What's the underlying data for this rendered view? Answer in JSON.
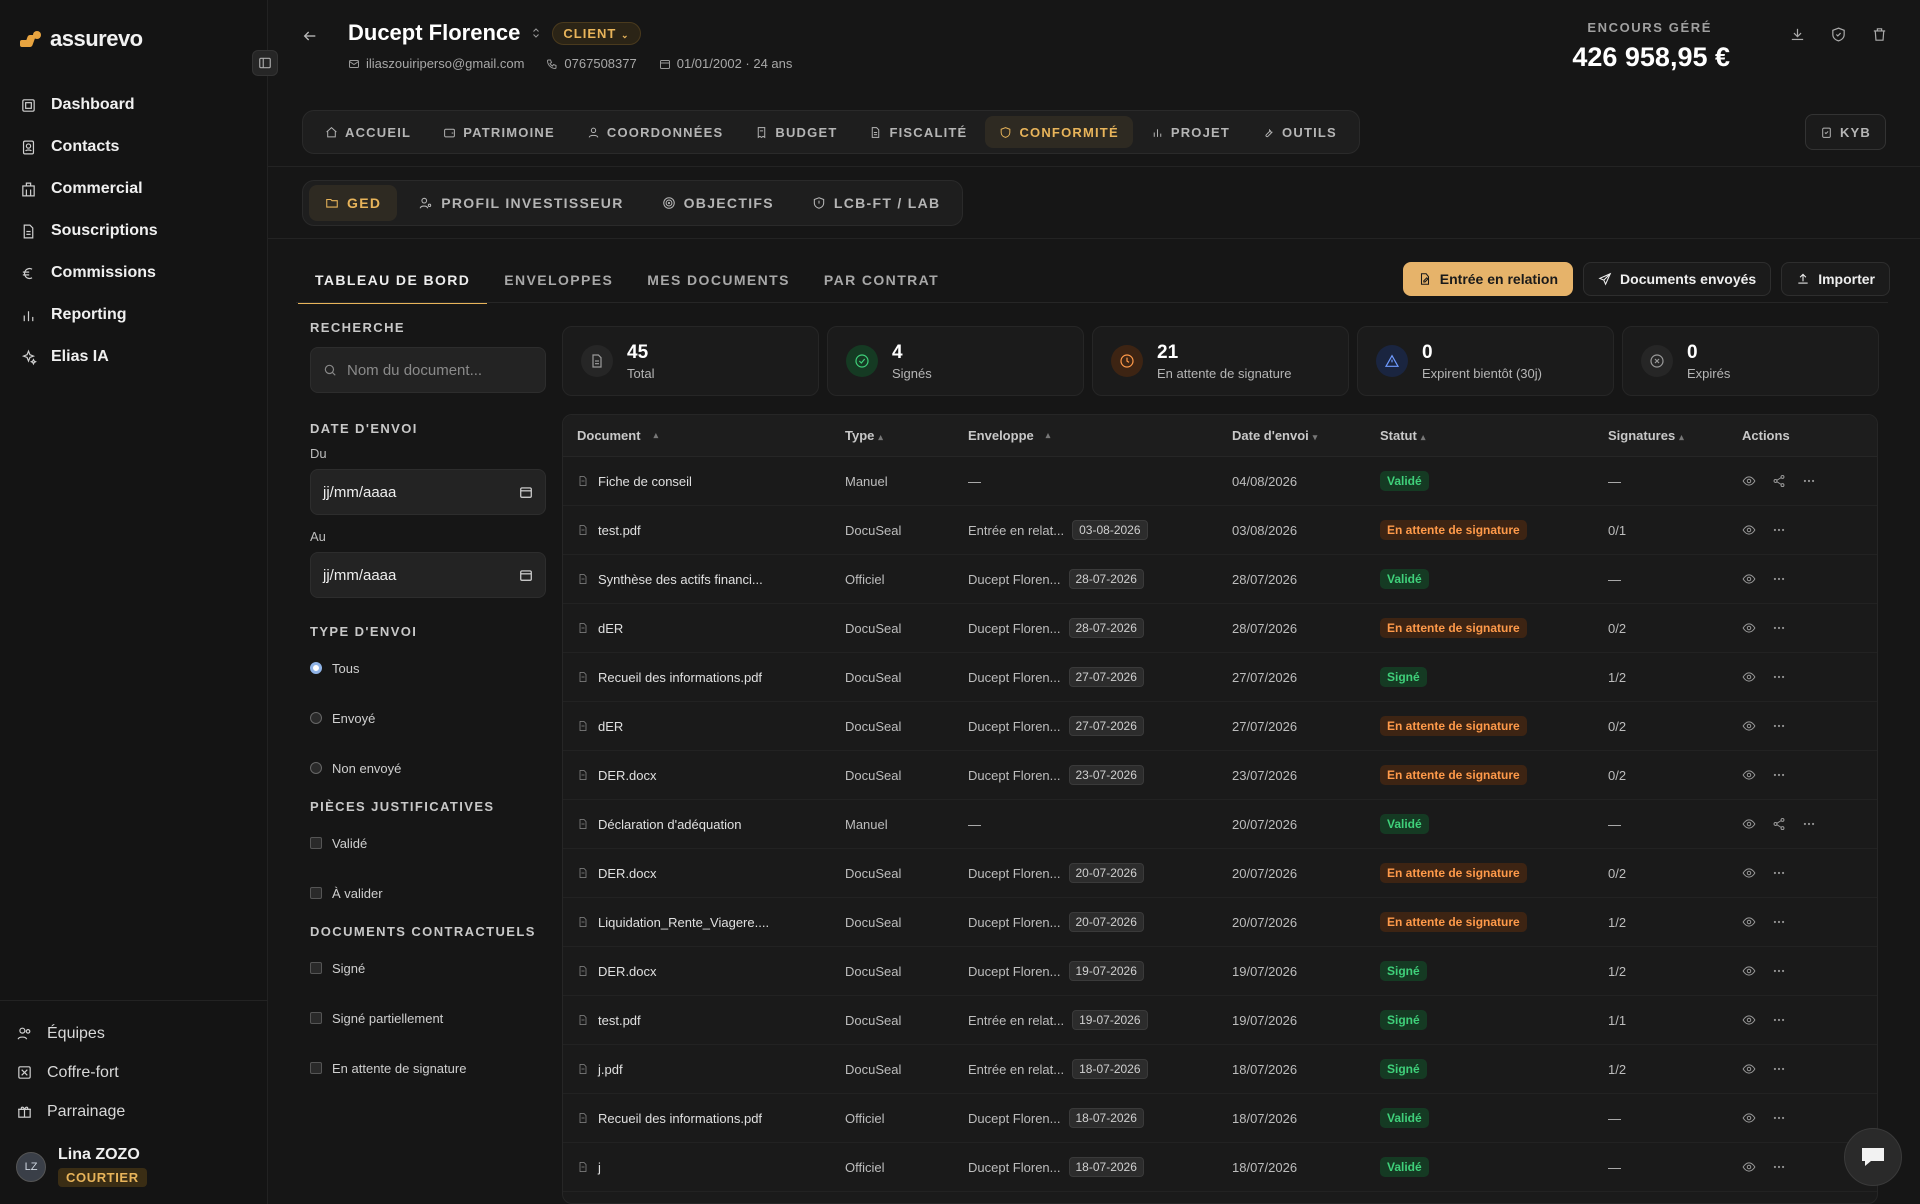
{
  "app": {
    "brand": "assurevo"
  },
  "sidebar": {
    "items": [
      {
        "label": "Dashboard",
        "icon": "dashboard-icon"
      },
      {
        "label": "Contacts",
        "icon": "contacts-icon"
      },
      {
        "label": "Commercial",
        "icon": "building-icon"
      },
      {
        "label": "Souscriptions",
        "icon": "file-icon"
      },
      {
        "label": "Commissions",
        "icon": "euro-icon"
      },
      {
        "label": "Reporting",
        "icon": "chart-icon"
      },
      {
        "label": "Elias IA",
        "icon": "sparkles-icon"
      }
    ],
    "bottom_items": [
      {
        "label": "Équipes",
        "icon": "users-icon"
      },
      {
        "label": "Coffre-fort",
        "icon": "vault-icon"
      },
      {
        "label": "Parrainage",
        "icon": "gift-icon"
      }
    ],
    "user": {
      "initials": "LZ",
      "name": "Lina ZOZO",
      "role": "COURTIER"
    }
  },
  "header": {
    "client_name": "Ducept Florence",
    "client_badge": "CLIENT",
    "email": "iliaszouiriperso@gmail.com",
    "phone": "0767508377",
    "birth": "01/01/2002 · 24 ans",
    "encours_label": "ENCOURS GÉRÉ",
    "encours_value": "426 958,95 €"
  },
  "tabs_main": [
    {
      "label": "ACCUEIL"
    },
    {
      "label": "PATRIMOINE"
    },
    {
      "label": "COORDONNÉES"
    },
    {
      "label": "BUDGET"
    },
    {
      "label": "FISCALITÉ"
    },
    {
      "label": "CONFORMITÉ",
      "active": true
    },
    {
      "label": "PROJET"
    },
    {
      "label": "OUTILS"
    }
  ],
  "kyb_label": "KYB",
  "tabs_sub": [
    {
      "label": "GED",
      "active": true
    },
    {
      "label": "PROFIL INVESTISSEUR"
    },
    {
      "label": "OBJECTIFS"
    },
    {
      "label": "LCB-FT / LAB"
    }
  ],
  "tabs_ged": [
    {
      "label": "TABLEAU DE BORD",
      "active": true
    },
    {
      "label": "ENVELOPPES"
    },
    {
      "label": "MES DOCUMENTS"
    },
    {
      "label": "PAR CONTRAT"
    }
  ],
  "actions": {
    "entree": "Entrée en relation",
    "envoyes": "Documents envoyés",
    "importer": "Importer"
  },
  "filters": {
    "search_title": "RECHERCHE",
    "search_placeholder": "Nom du document...",
    "date_title": "DATE D'ENVOI",
    "du_label": "Du",
    "au_label": "Au",
    "date_placeholder": "jj/mm/aaaa",
    "type_title": "TYPE D'ENVOI",
    "type_options": [
      "Tous",
      "Envoyé",
      "Non envoyé"
    ],
    "pieces_title": "PIÈCES JUSTIFICATIVES",
    "pieces_options": [
      "Validé",
      "À valider"
    ],
    "contrat_title": "DOCUMENTS CONTRACTUELS",
    "contrat_options": [
      "Signé",
      "Signé partiellement",
      "En attente de signature"
    ]
  },
  "stats": [
    {
      "value": "45",
      "label": "Total",
      "color": "#9a9a9a",
      "bg": "#262626"
    },
    {
      "value": "4",
      "label": "Signés",
      "color": "#3fd07a",
      "bg": "#153a23"
    },
    {
      "value": "21",
      "label": "En attente de signature",
      "color": "#ff9a4a",
      "bg": "#3d2413"
    },
    {
      "value": "0",
      "label": "Expirent bientôt (30j)",
      "color": "#6f9bff",
      "bg": "#1a2540"
    },
    {
      "value": "0",
      "label": "Expirés",
      "color": "#9a9a9a",
      "bg": "#262626"
    }
  ],
  "table": {
    "headers": [
      "Document",
      "Type",
      "Enveloppe",
      "Date d'envoi",
      "Statut",
      "Signatures",
      "Actions"
    ],
    "rows": [
      {
        "doc": "Fiche de conseil",
        "type": "Manuel",
        "env": "—",
        "env_date": "",
        "date": "04/08/2026",
        "status": "Validé",
        "sig": "—",
        "share": true
      },
      {
        "doc": "test.pdf",
        "type": "DocuSeal",
        "env": "Entrée en relat...",
        "env_date": "03-08-2026",
        "date": "03/08/2026",
        "status": "En attente de signature",
        "sig": "0/1",
        "share": false
      },
      {
        "doc": "Synthèse des actifs financi...",
        "type": "Officiel",
        "env": "Ducept Floren...",
        "env_date": "28-07-2026",
        "date": "28/07/2026",
        "status": "Validé",
        "sig": "—",
        "share": false
      },
      {
        "doc": "dER",
        "type": "DocuSeal",
        "env": "Ducept Floren...",
        "env_date": "28-07-2026",
        "date": "28/07/2026",
        "status": "En attente de signature",
        "sig": "0/2",
        "share": false
      },
      {
        "doc": "Recueil des informations.pdf",
        "type": "DocuSeal",
        "env": "Ducept Floren...",
        "env_date": "27-07-2026",
        "date": "27/07/2026",
        "status": "Signé",
        "sig": "1/2",
        "share": false
      },
      {
        "doc": "dER",
        "type": "DocuSeal",
        "env": "Ducept Floren...",
        "env_date": "27-07-2026",
        "date": "27/07/2026",
        "status": "En attente de signature",
        "sig": "0/2",
        "share": false
      },
      {
        "doc": "DER.docx",
        "type": "DocuSeal",
        "env": "Ducept Floren...",
        "env_date": "23-07-2026",
        "date": "23/07/2026",
        "status": "En attente de signature",
        "sig": "0/2",
        "share": false
      },
      {
        "doc": "Déclaration d'adéquation",
        "type": "Manuel",
        "env": "—",
        "env_date": "",
        "date": "20/07/2026",
        "status": "Validé",
        "sig": "—",
        "share": true
      },
      {
        "doc": "DER.docx",
        "type": "DocuSeal",
        "env": "Ducept Floren...",
        "env_date": "20-07-2026",
        "date": "20/07/2026",
        "status": "En attente de signature",
        "sig": "0/2",
        "share": false
      },
      {
        "doc": "Liquidation_Rente_Viagere....",
        "type": "DocuSeal",
        "env": "Ducept Floren...",
        "env_date": "20-07-2026",
        "date": "20/07/2026",
        "status": "En attente de signature",
        "sig": "1/2",
        "share": false
      },
      {
        "doc": "DER.docx",
        "type": "DocuSeal",
        "env": "Ducept Floren...",
        "env_date": "19-07-2026",
        "date": "19/07/2026",
        "status": "Signé",
        "sig": "1/2",
        "share": false
      },
      {
        "doc": "test.pdf",
        "type": "DocuSeal",
        "env": "Entrée en relat...",
        "env_date": "19-07-2026",
        "date": "19/07/2026",
        "status": "Signé",
        "sig": "1/1",
        "share": false
      },
      {
        "doc": "j.pdf",
        "type": "DocuSeal",
        "env": "Entrée en relat...",
        "env_date": "18-07-2026",
        "date": "18/07/2026",
        "status": "Signé",
        "sig": "1/2",
        "share": false
      },
      {
        "doc": "Recueil des informations.pdf",
        "type": "Officiel",
        "env": "Ducept Floren...",
        "env_date": "18-07-2026",
        "date": "18/07/2026",
        "status": "Validé",
        "sig": "—",
        "share": false
      },
      {
        "doc": "j",
        "type": "Officiel",
        "env": "Ducept Floren...",
        "env_date": "18-07-2026",
        "date": "18/07/2026",
        "status": "Validé",
        "sig": "—",
        "share": false
      }
    ]
  }
}
